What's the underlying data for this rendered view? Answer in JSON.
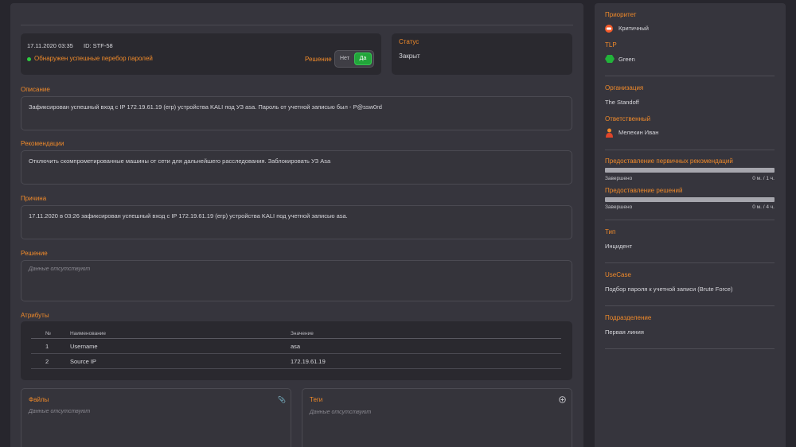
{
  "header": {
    "datetime": "17.11.2020 03:35",
    "id": "ID: STF-58",
    "alert": "Обнаружен успешные перебор паролей",
    "decision_label": "Решение",
    "toggle_no": "Нет",
    "toggle_yes": "Да"
  },
  "status": {
    "title": "Статус",
    "value": "Закрыт"
  },
  "description": {
    "title": "Описание",
    "text": "Зафиксирован успешный вход с IP 172.19.61.19 (erp) устройства KALI под УЗ asa. Пароль от учетной записью был -  P@ssw0rd"
  },
  "recommendations": {
    "title": "Рекомендации",
    "text": "Отключить скомпрометированные машины от сети для дальнейшего расследования. Заблокировать УЗ Asa"
  },
  "cause": {
    "title": "Причина",
    "text": "17.11.2020 в 03:26 зафиксирован успешный вход с IP 172.19.61.19 (erp) устройства KALI под учетной записью asa."
  },
  "solution": {
    "title": "Решение",
    "empty": "Данные отсутствуют"
  },
  "attributes": {
    "title": "Атрибуты",
    "columns": [
      "№",
      "Наименование",
      "Значение"
    ],
    "rows": [
      {
        "n": "1",
        "name": "Username",
        "value": "asa"
      },
      {
        "n": "2",
        "name": "Source IP",
        "value": "172.19.61.19"
      }
    ]
  },
  "files": {
    "title": "Файлы",
    "empty": "Данные отсутствуют"
  },
  "tags": {
    "title": "Теги",
    "empty": "Данные отсутствуют"
  },
  "sidebar": {
    "priority_title": "Приоритет",
    "priority_value": "Критичный",
    "tlp_title": "TLP",
    "tlp_value": "Green",
    "org_title": "Организация",
    "org_value": "The Standoff",
    "responsible_title": "Ответственный",
    "responsible_value": "Мелехин Иван",
    "sla1_title": "Предоставление первичных рекомендаций",
    "sla1_status": "Завершено",
    "sla1_time": "0 м. / 1 ч.",
    "sla2_title": "Предоставление решений",
    "sla2_status": "Завершено",
    "sla2_time": "0 м. / 4 ч.",
    "type_title": "Тип",
    "type_value": "Инцидент",
    "usecase_title": "UseCase",
    "usecase_value": "Подбор пароля к учетной записи (Brute Force)",
    "division_title": "Подразделение",
    "division_value": "Первая линия"
  },
  "colors": {
    "accent": "#f08a2a",
    "success": "#22a63a",
    "panel": "#36353d",
    "background": "#27262d"
  }
}
